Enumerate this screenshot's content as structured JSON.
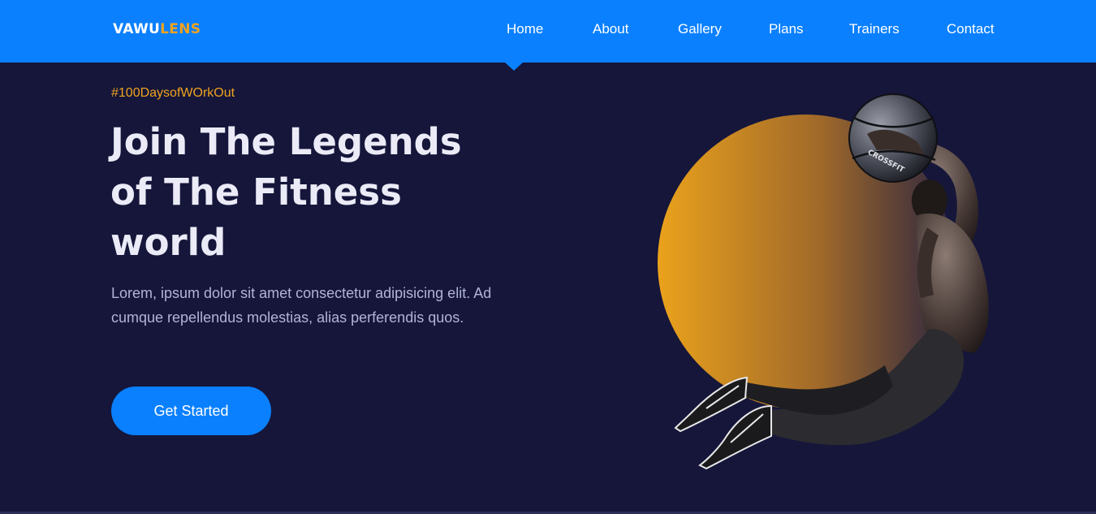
{
  "brand": {
    "prefix": "VAWU",
    "suffix": "LENS"
  },
  "nav": {
    "items": [
      {
        "label": "Home"
      },
      {
        "label": "About"
      },
      {
        "label": "Gallery"
      },
      {
        "label": "Plans"
      },
      {
        "label": "Trainers"
      },
      {
        "label": "Contact"
      }
    ],
    "active": "Home"
  },
  "hero": {
    "hashtag": "#100DaysofWOrkOut",
    "title_lines": [
      "Join The Legends",
      "of The Fitness",
      "world"
    ],
    "description": "Lorem, ipsum dolor sit amet consectetur adipisicing elit. Ad cumque repellendus molestias, alias perferendis quos.",
    "cta_label": "Get Started",
    "ball_text": "CROSSFIT"
  },
  "colors": {
    "background": "#15163a",
    "navbar": "#0a80ff",
    "accent": "#f0a31e",
    "heading": "#ebebf7",
    "body_text": "#b2b3d8"
  }
}
